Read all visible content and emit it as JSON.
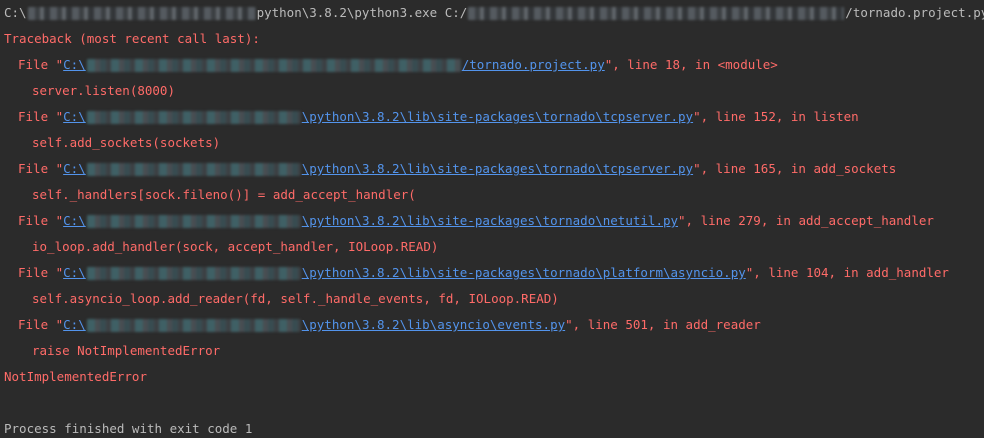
{
  "console": {
    "command": {
      "prefix": "C:\\",
      "exe_suffix": "python\\3.8.2\\python3.exe C:/",
      "script_suffix": "/tornado.project.py"
    },
    "traceback_header": "Traceback (most recent call last):",
    "frames": [
      {
        "file_prefix": "File \"",
        "drive": "C:\\",
        "path_suffix": "/tornado.project.py",
        "location": "\", line 18, in <module>",
        "code": "server.listen(8000)"
      },
      {
        "file_prefix": "File \"",
        "drive": "C:\\",
        "path_suffix": "\\python\\3.8.2\\lib\\site-packages\\tornado\\tcpserver.py",
        "location": "\", line 152, in listen",
        "code": "self.add_sockets(sockets)"
      },
      {
        "file_prefix": "File \"",
        "drive": "C:\\",
        "path_suffix": "\\python\\3.8.2\\lib\\site-packages\\tornado\\tcpserver.py",
        "location": "\", line 165, in add_sockets",
        "code": "self._handlers[sock.fileno()] = add_accept_handler("
      },
      {
        "file_prefix": "File \"",
        "drive": "C:\\",
        "path_suffix": "\\python\\3.8.2\\lib\\site-packages\\tornado\\netutil.py",
        "location": "\", line 279, in add_accept_handler",
        "code": "io_loop.add_handler(sock, accept_handler, IOLoop.READ)"
      },
      {
        "file_prefix": "File \"",
        "drive": "C:\\",
        "path_suffix": "\\python\\3.8.2\\lib\\site-packages\\tornado\\platform\\asyncio.py",
        "location": "\", line 104, in add_handler",
        "code": "self.asyncio_loop.add_reader(fd, self._handle_events, fd, IOLoop.READ)"
      },
      {
        "file_prefix": "File \"",
        "drive": "C:\\",
        "path_suffix": "\\python\\3.8.2\\lib\\asyncio\\events.py",
        "location": "\", line 501, in add_reader",
        "code": "raise NotImplementedError"
      }
    ],
    "exception": "NotImplementedError",
    "finish_message": "Process finished with exit code 1"
  },
  "colors": {
    "background": "#2b2b2b",
    "error_text": "#ff6b68",
    "normal_text": "#bbbbbb",
    "link": "#5394ec"
  }
}
